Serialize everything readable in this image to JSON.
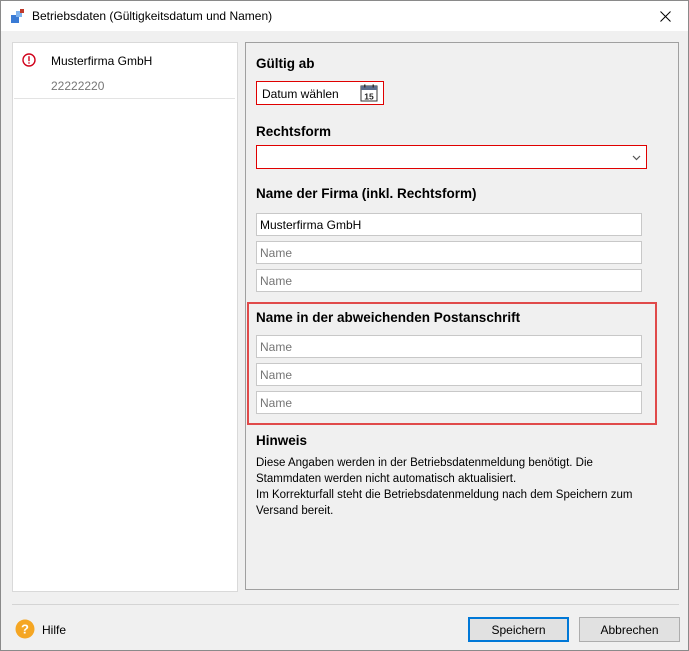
{
  "window": {
    "title": "Betriebsdaten (Gültigkeitsdatum und Namen)"
  },
  "sidebar": {
    "items": [
      {
        "name": "Musterfirma GmbH",
        "number": "22222220",
        "status": "error"
      }
    ]
  },
  "form": {
    "valid_from": {
      "label": "Gültig ab",
      "placeholder": "Datum wählen",
      "calendar_day": "15"
    },
    "legal_form": {
      "label": "Rechtsform",
      "selected": ""
    },
    "company_name": {
      "label": "Name der Firma (inkl. Rechtsform)",
      "fields": [
        {
          "value": "Musterfirma GmbH",
          "placeholder": "Name"
        },
        {
          "value": "",
          "placeholder": "Name"
        },
        {
          "value": "",
          "placeholder": "Name"
        }
      ]
    },
    "postal_name": {
      "label": "Name in der abweichenden Postanschrift",
      "fields": [
        {
          "value": "",
          "placeholder": "Name"
        },
        {
          "value": "",
          "placeholder": "Name"
        },
        {
          "value": "",
          "placeholder": "Name"
        }
      ]
    },
    "hint": {
      "label": "Hinweis",
      "lines": [
        "Diese Angaben werden in der Betriebsdatenmeldung benötigt. Die",
        "Stammdaten werden nicht automatisch aktualisiert.",
        "Im Korrekturfall steht die Betriebsdatenmeldung nach dem Speichern zum",
        "Versand bereit."
      ]
    }
  },
  "footer": {
    "help_label": "Hilfe",
    "save_label": "Speichern",
    "cancel_label": "Abbrechen"
  },
  "colors": {
    "error_border": "#e00000",
    "highlight_border": "#e04a4a",
    "primary_button_border": "#0078d7",
    "help_icon": "#f5a623"
  }
}
